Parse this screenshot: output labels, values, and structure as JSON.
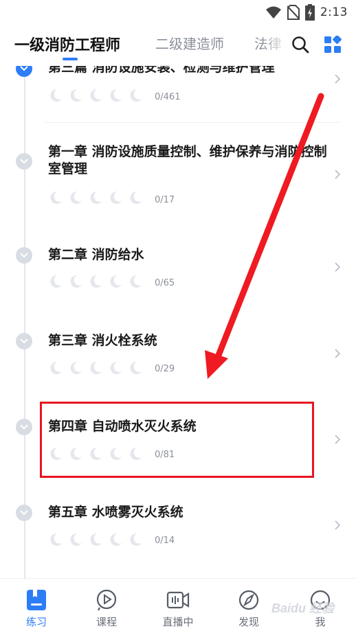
{
  "status_bar": {
    "time": "2:13"
  },
  "header": {
    "tabs": [
      {
        "label": "一级消防工程师",
        "active": true
      },
      {
        "label": "二级建造师",
        "active": false
      },
      {
        "label": "法律",
        "active": false
      }
    ]
  },
  "list": {
    "items": [
      {
        "title": "第三篇 消防设施安装、检测与维护管理",
        "progress": "0/461",
        "node": "blue"
      },
      {
        "title": "第一章 消防设施质量控制、维护保养与消防控制室管理",
        "progress": "0/17",
        "node": "gray"
      },
      {
        "title": "第二章 消防给水",
        "progress": "0/65",
        "node": "gray"
      },
      {
        "title": "第三章 消火栓系统",
        "progress": "0/29",
        "node": "gray"
      },
      {
        "title": "第四章 自动喷水灭火系统",
        "progress": "0/81",
        "node": "gray"
      },
      {
        "title": "第五章 水喷雾灭火系统",
        "progress": "0/14",
        "node": "gray"
      }
    ]
  },
  "bottom_nav": [
    {
      "label": "练习",
      "icon": "book-icon",
      "active": true
    },
    {
      "label": "课程",
      "icon": "play-icon",
      "active": false
    },
    {
      "label": "直播中",
      "icon": "live-icon",
      "active": false
    },
    {
      "label": "发现",
      "icon": "compass-icon",
      "active": false
    },
    {
      "label": "我",
      "icon": "profile-icon",
      "active": false
    }
  ],
  "watermark": "Baidu 经验",
  "colors": {
    "accent": "#2d7df6",
    "highlight": "#e8141f"
  }
}
